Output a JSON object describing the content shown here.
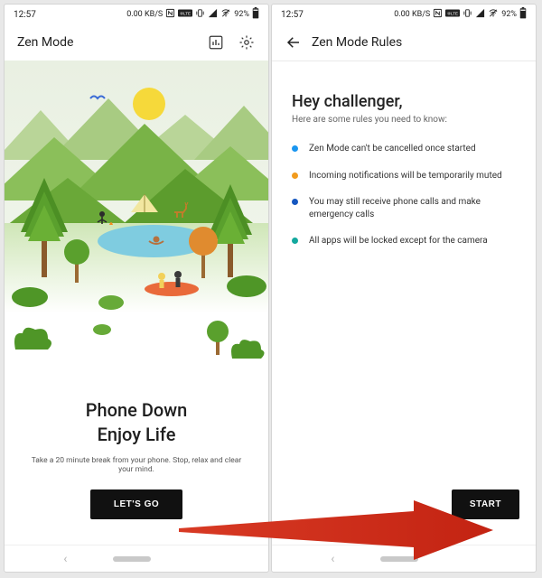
{
  "statusbar": {
    "time": "12:57",
    "net_speed": "0.00 KB/S",
    "battery_pct": "92%"
  },
  "left": {
    "title": "Zen Mode",
    "hero_line1": "Phone Down",
    "hero_line2": "Enjoy Life",
    "hero_sub": "Take a 20 minute break from your phone. Stop, relax and clear your mind.",
    "cta": "LET'S GO"
  },
  "right": {
    "title": "Zen Mode Rules",
    "heading": "Hey challenger,",
    "sub": "Here are some rules you need to know:",
    "rules": [
      {
        "color": "#1a96f0",
        "text": "Zen Mode can't be cancelled once started"
      },
      {
        "color": "#f29b1d",
        "text": "Incoming notifications will be temporarily muted"
      },
      {
        "color": "#1557c0",
        "text": "You may still receive phone calls and make emergency calls"
      },
      {
        "color": "#13a89e",
        "text": "All apps will be locked except for the camera"
      }
    ],
    "cta": "START"
  },
  "icons": {
    "stats": "stats-icon",
    "gear": "gear-icon",
    "back": "back-icon"
  }
}
